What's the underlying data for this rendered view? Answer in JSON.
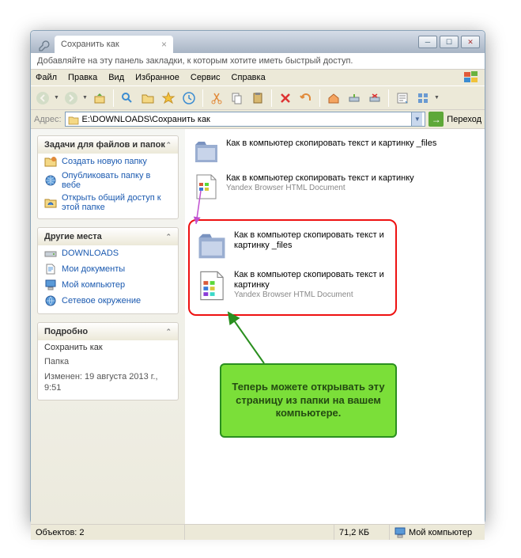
{
  "browser": {
    "tab_title": "Сохранить как",
    "bookmark_hint": "Добавляйте на эту панель закладки, к которым хотите иметь быстрый доступ."
  },
  "menu": {
    "file": "Файл",
    "edit": "Правка",
    "view": "Вид",
    "favorites": "Избранное",
    "tools": "Сервис",
    "help": "Справка"
  },
  "address": {
    "label": "Адрес:",
    "path": "E:\\DOWNLOADS\\Сохранить как",
    "go": "Переход"
  },
  "sidebar": {
    "tasks": {
      "header": "Задачи для файлов и папок",
      "items": [
        "Создать новую папку",
        "Опубликовать папку в вебе",
        "Открыть общий доступ к этой папке"
      ]
    },
    "places": {
      "header": "Другие места",
      "items": [
        "DOWNLOADS",
        "Мои документы",
        "Мой компьютер",
        "Сетевое окружение"
      ]
    },
    "details": {
      "header": "Подробно",
      "name": "Сохранить как",
      "type": "Папка",
      "modified": "Изменен: 19 августа 2013 г., 9:51"
    }
  },
  "files": {
    "item1_name": "Как в компьютер скопировать текст и картинку _files",
    "item2_name": "Как в компьютер скопировать текст и картинку",
    "item2_type": "Yandex Browser HTML Document"
  },
  "callouts": {
    "red_item1": "Как в компьютер скопировать текст и картинку _files",
    "red_item2": "Как в компьютер скопировать текст и картинку",
    "red_item2_type": "Yandex Browser HTML Document",
    "green_text": "Теперь можете открывать эту страницу из папки на вашем компьютере."
  },
  "status": {
    "objects": "Объектов: 2",
    "size": "71,2 КБ",
    "location": "Мой компьютер"
  }
}
